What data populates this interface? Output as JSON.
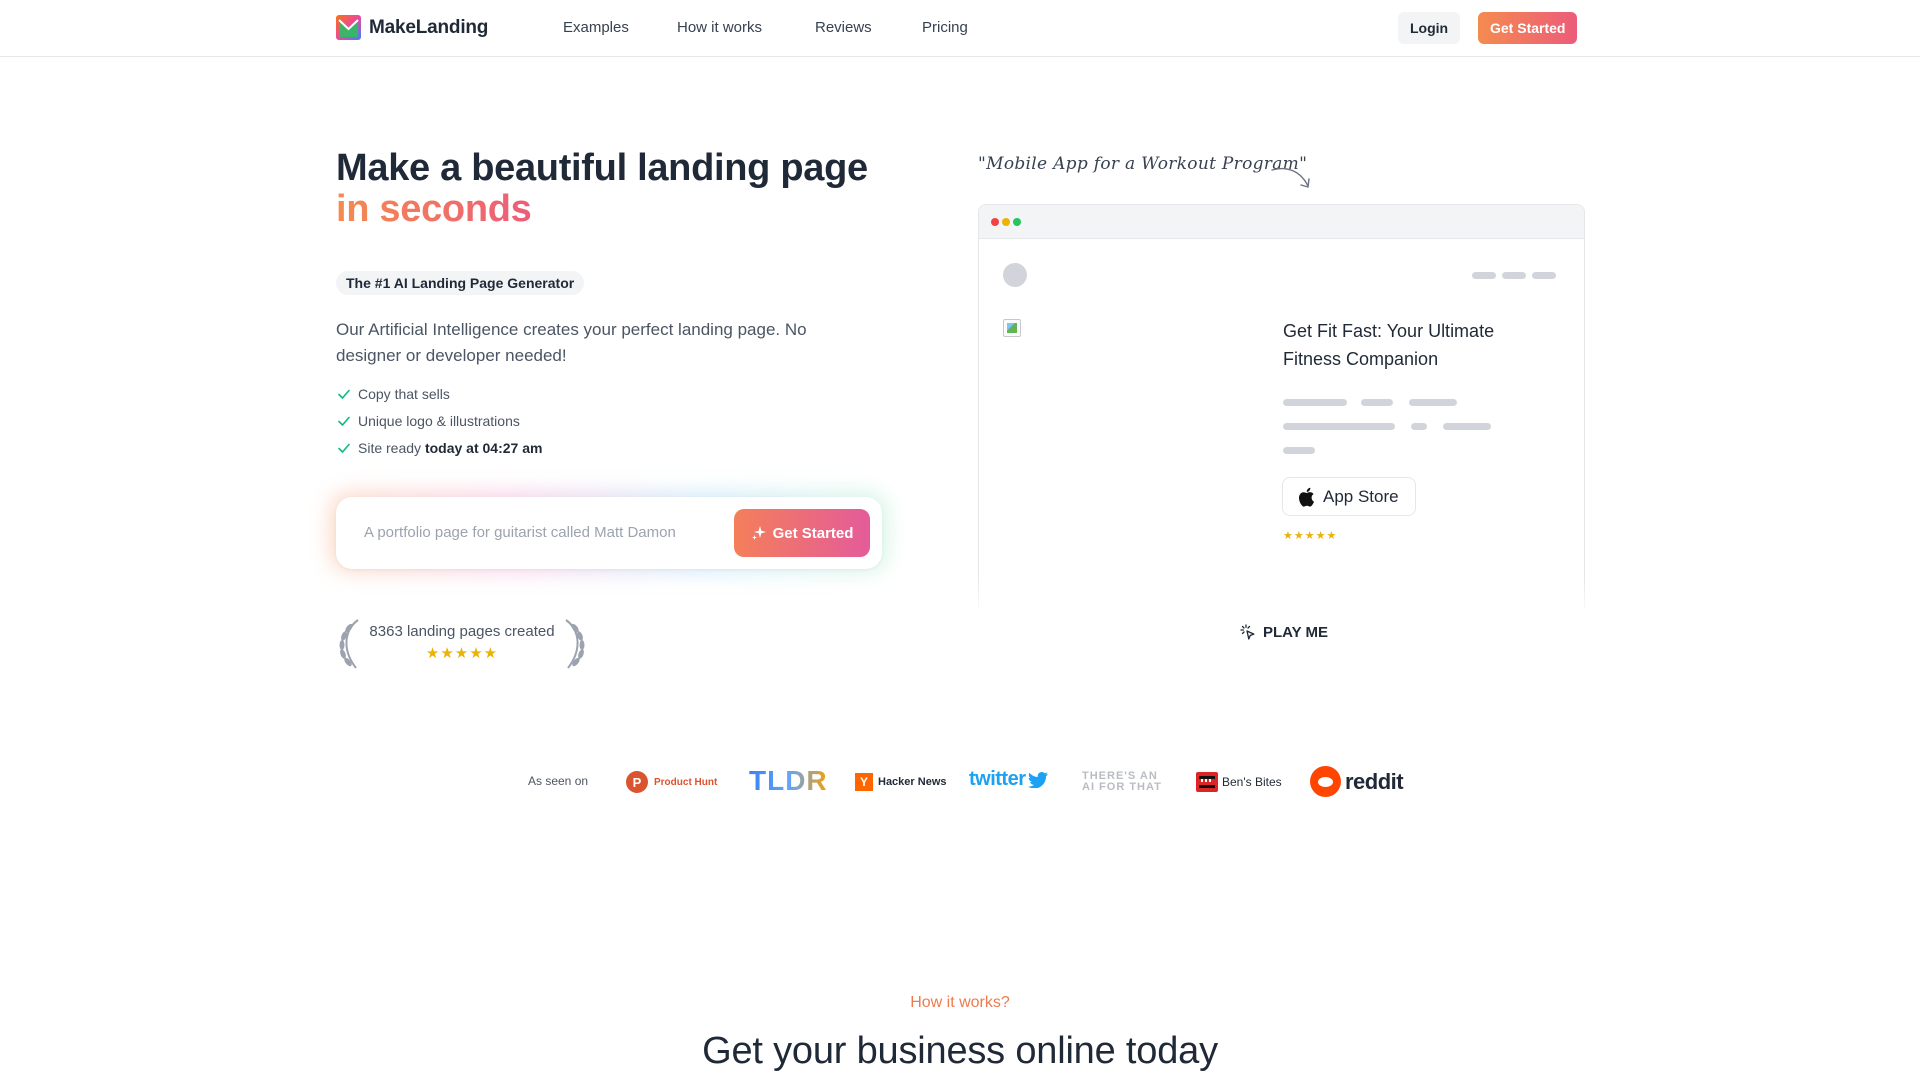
{
  "nav": {
    "brand": "MakeLanding",
    "links": [
      "Examples",
      "How it works",
      "Reviews",
      "Pricing"
    ],
    "login_label": "Login",
    "get_started_label": "Get Started"
  },
  "hero": {
    "title_line1": "Make a beautiful landing page",
    "title_line2": "in seconds",
    "badge": "The #1 AI Landing Page Generator",
    "description": "Our Artificial Intelligence creates your perfect landing page. No designer or developer needed!",
    "features": [
      {
        "text": "Copy that sells",
        "bold": ""
      },
      {
        "text": "Unique logo & illustrations",
        "bold": ""
      },
      {
        "text": "Site ready ",
        "bold": "today at 04:27 am"
      }
    ],
    "prompt_placeholder": "A portfolio page for guitarist called Matt Damon",
    "prompt_button": "Get Started",
    "count_text": "8363 landing pages created",
    "count_stars": "★★★★★",
    "count_rating": 5
  },
  "preview": {
    "caption": "\"Mobile App for a Workout Program\"",
    "headline": "Get Fit Fast: Your Ultimate Fitness Companion",
    "app_store_label": "App Store",
    "stars": "★★★★★",
    "rating": 5,
    "play_label": "PLAY ME"
  },
  "seen_on": {
    "label": "As seen on",
    "logos": [
      {
        "icon": "product-hunt-icon",
        "letter": "P",
        "name": "Product Hunt"
      },
      {
        "name": "TLDR"
      },
      {
        "icon": "hacker-news-icon",
        "letter": "Y",
        "name": "Hacker News"
      },
      {
        "name": "twitter"
      },
      {
        "name_line1": "THERE'S AN",
        "name_line2": "AI FOR THAT"
      },
      {
        "icon": "bens-bites-icon",
        "name": "Ben's Bites"
      },
      {
        "icon": "reddit-icon",
        "name": "reddit"
      }
    ]
  },
  "how": {
    "label": "How it works?",
    "title": "Get your business online today"
  },
  "colors": {
    "accent_start": "#f48b4f",
    "accent_end": "#ec5c7a",
    "text": "#1f2937",
    "star": "#eab308"
  }
}
